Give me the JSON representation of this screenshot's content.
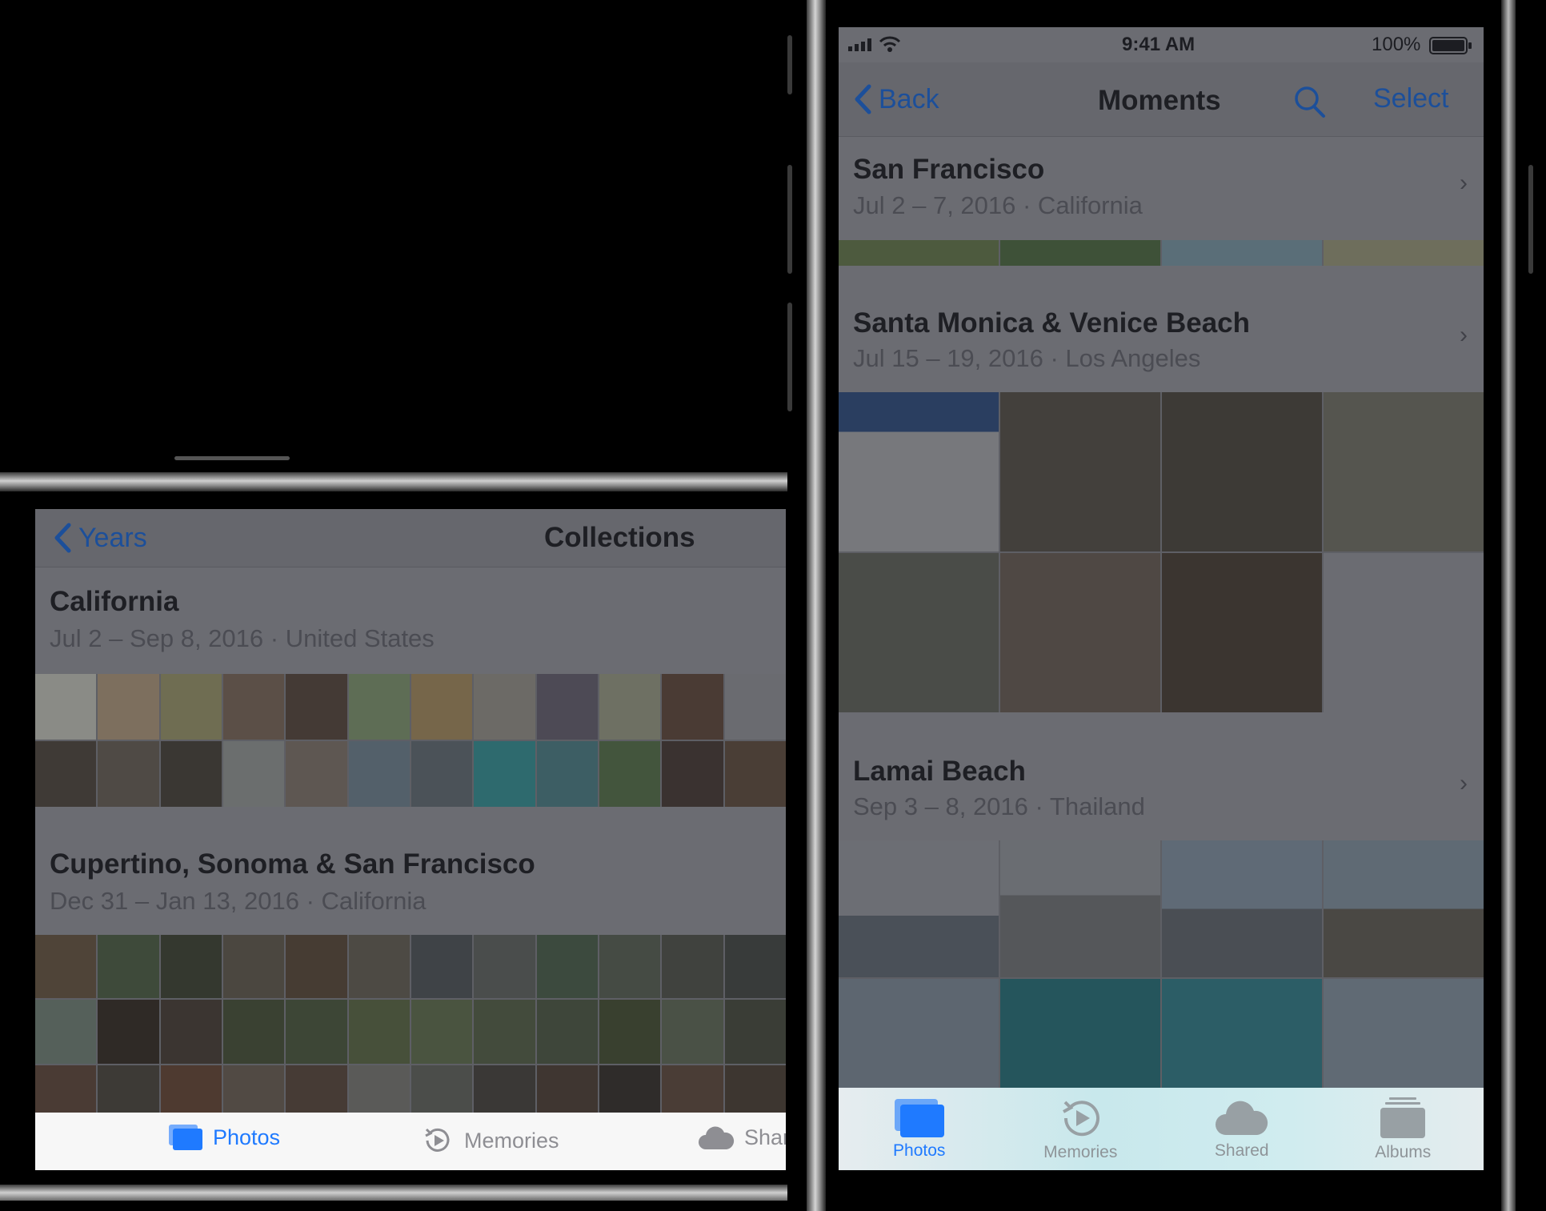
{
  "left_screen": {
    "nav": {
      "back_label": "Years",
      "title": "Collections"
    },
    "sections": [
      {
        "title": "California",
        "subtitle": "Jul 2 – Sep 8, 2016 · United States"
      },
      {
        "title": "Cupertino, Sonoma & San Francisco",
        "subtitle": "Dec 31 – Jan 13, 2016 · California"
      }
    ],
    "tabbar": {
      "photos": "Photos",
      "memories": "Memories",
      "shared": "Shar"
    }
  },
  "right_screen": {
    "status": {
      "time": "9:41 AM",
      "battery": "100%"
    },
    "nav": {
      "back_label": "Back",
      "title": "Moments",
      "select_label": "Select"
    },
    "sections": [
      {
        "title": "San Francisco",
        "subtitle": "Jul 2 – 7, 2016 · California"
      },
      {
        "title": "Santa Monica & Venice Beach",
        "subtitle": "Jul 15 – 19, 2016 · Los Angeles"
      },
      {
        "title": "Lamai Beach",
        "subtitle": "Sep 3 – 8, 2016 · Thailand"
      }
    ],
    "tabbar": {
      "photos": "Photos",
      "memories": "Memories",
      "shared": "Shared",
      "albums": "Albums"
    }
  },
  "colors": {
    "accent": "#1f7aff",
    "dimmed_accent": "#1c4f9a",
    "tabbar_bg": "#f7f7f7"
  }
}
